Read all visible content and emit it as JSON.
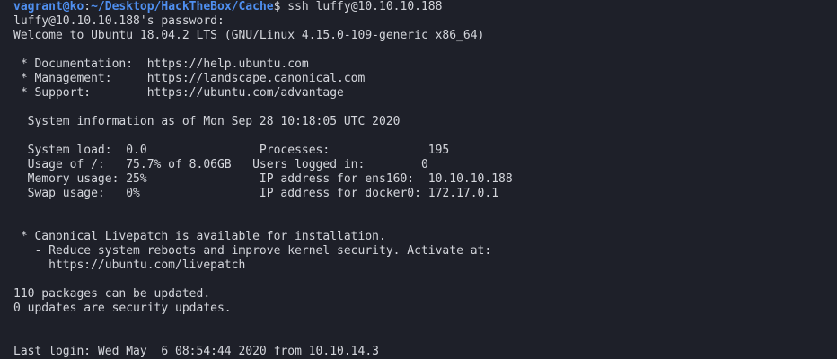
{
  "prompt": {
    "user_host": "vagrant@ko",
    "separator": ":",
    "path": "~/Desktop/HackTheBox/Cache",
    "symbol": "$ ",
    "command": "ssh luffy@10.10.10.188"
  },
  "output": [
    "luffy@10.10.10.188's password:",
    "Welcome to Ubuntu 18.04.2 LTS (GNU/Linux 4.15.0-109-generic x86_64)",
    "",
    " * Documentation:  https://help.ubuntu.com",
    " * Management:     https://landscape.canonical.com",
    " * Support:        https://ubuntu.com/advantage",
    "",
    "  System information as of Mon Sep 28 10:18:05 UTC 2020",
    "",
    "  System load:  0.0                Processes:              195",
    "  Usage of /:   75.7% of 8.06GB   Users logged in:        0",
    "  Memory usage: 25%                IP address for ens160:  10.10.10.188",
    "  Swap usage:   0%                 IP address for docker0: 172.17.0.1",
    "",
    "",
    " * Canonical Livepatch is available for installation.",
    "   - Reduce system reboots and improve kernel security. Activate at:",
    "     https://ubuntu.com/livepatch",
    "",
    "110 packages can be updated.",
    "0 updates are security updates.",
    "",
    "",
    "Last login: Wed May  6 08:54:44 2020 from 10.10.14.3"
  ]
}
